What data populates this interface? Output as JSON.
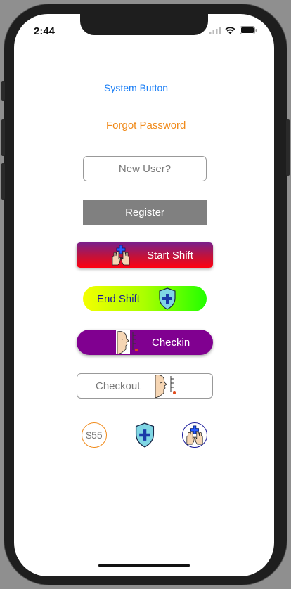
{
  "status_bar": {
    "time": "2:44"
  },
  "buttons": {
    "system_button": "System Button",
    "forgot_password": "Forgot Password",
    "new_user": "New User?",
    "register": "Register",
    "start_shift": "Start Shift",
    "end_shift": "End Shift",
    "checkin": "Checkin",
    "checkout": "Checkout",
    "price": "$55"
  },
  "colors": {
    "system_blue": "#1a7ef5",
    "forgot_orange": "#f08a1a",
    "register_gray": "#808080",
    "checkin_purple": "#800090",
    "price_border": "#f08a1a",
    "hands_circle_border": "#1a1a9a"
  },
  "icons": {
    "start_shift": "hands-plus-icon",
    "end_shift": "shield-plus-icon",
    "checkin": "face-profile-icon",
    "checkout": "face-profile-icon",
    "shield_standalone": "shield-plus-icon",
    "hands_circle": "hands-plus-icon"
  }
}
